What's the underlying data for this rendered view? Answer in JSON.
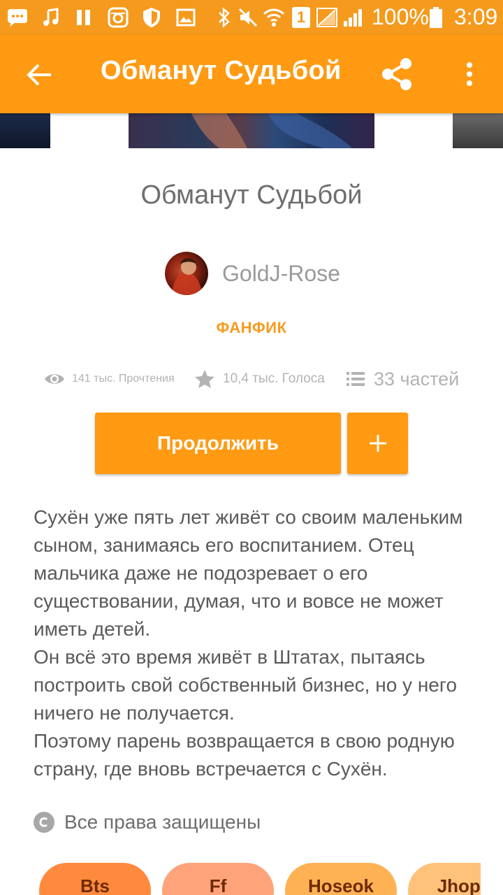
{
  "status_bar": {
    "battery": "100%",
    "time": "3:09",
    "sim": "1"
  },
  "app_bar": {
    "title": "Обманут Судьбой"
  },
  "story": {
    "title": "Обманут Судьбой",
    "author": "GoldJ-Rose",
    "genre": "ФАНФИК",
    "stats": {
      "reads": "141 тыс. Прочтения",
      "votes": "10,4 тыс. Голоса",
      "parts": "33 частей"
    },
    "continue_label": "Продолжить",
    "add_label": "+",
    "description": [
      "Сухён уже пять лет живёт со своим маленьким сыном, занимаясь его воспитанием. Отец мальчика даже не подозревает о его существовании, думая, что и вовсе не может иметь детей.",
      "Он всё это время живёт в Штатах, пытаясь построить свой собственный бизнес, но у него ничего не получается.",
      "Поэтому парень возвращается в свою родную страну, где вновь встречается с Сухён."
    ],
    "copyright": "Все права защищены",
    "tags": [
      "Bts",
      "Ff",
      "Hoseok",
      "Jhope"
    ]
  },
  "colors": {
    "accent": "#ff9a12",
    "status_bar": "#f59a1d",
    "genre_text": "#f79a1e",
    "tag_colors": [
      "#ff8a3d",
      "#ffa47a",
      "#ffb254",
      "#ffc27a"
    ]
  }
}
